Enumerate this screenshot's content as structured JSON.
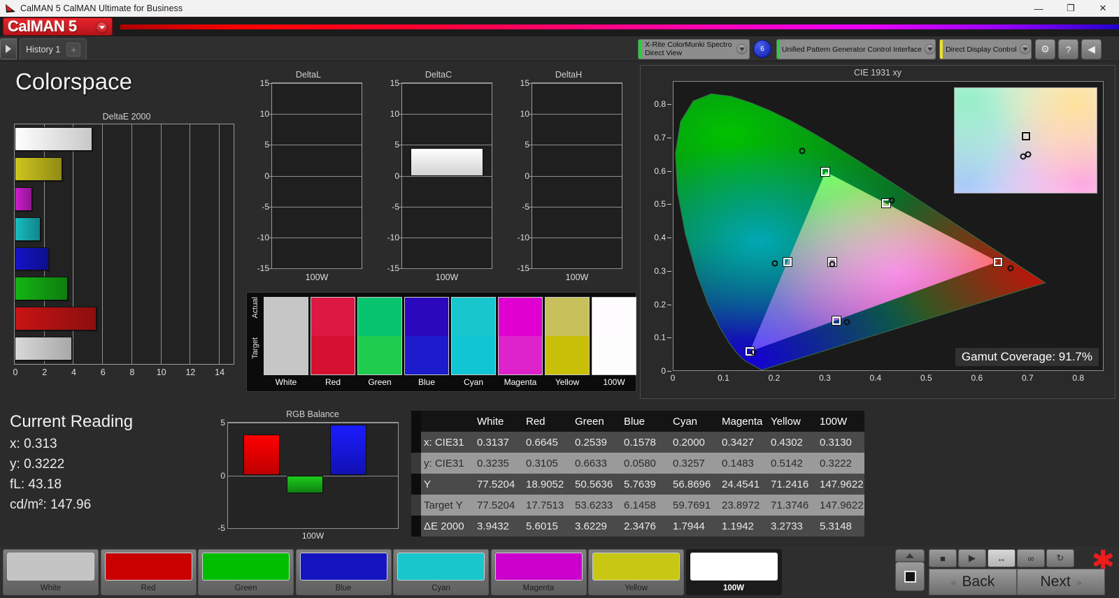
{
  "window": {
    "title": "CalMAN 5 CalMAN Ultimate for Business",
    "app_icon": "calman-logo-icon",
    "controls": {
      "minimize": "—",
      "maximize": "❐",
      "close": "✕"
    }
  },
  "brand": {
    "logo_text": "CalMAN 5",
    "dropdown_icon": "chevron-down-icon"
  },
  "toolbar": {
    "history_tab": "History 1",
    "add_tab": "+",
    "play_icon": "play-icon",
    "meter": {
      "line1": "X-Rite ColorMunki Spectro",
      "line2": "Direct View",
      "stripe_color": "#22d13c"
    },
    "badge": "6",
    "pattern_source": {
      "line1": "Unified Pattern Generator Control Interface",
      "stripe_color": "#22d13c"
    },
    "display_control": {
      "line1": "Direct Display Control",
      "stripe_color": "#e8e22a"
    },
    "buttons": [
      {
        "name": "settings-button",
        "glyph": "⚙"
      },
      {
        "name": "help-button",
        "glyph": "?"
      },
      {
        "name": "collapse-button",
        "glyph": "◀"
      }
    ]
  },
  "page_title": "Colorspace",
  "chart_data": [
    {
      "type": "bar",
      "title": "DeltaE 2000",
      "orientation": "horizontal",
      "categories": [
        "100W",
        "Yellow",
        "Magenta",
        "Cyan",
        "Blue",
        "Green",
        "Red",
        "White"
      ],
      "values": [
        5.3148,
        3.2733,
        1.1942,
        1.7944,
        2.3476,
        3.6229,
        5.6015,
        3.9432
      ],
      "colors": [
        "#ffffff",
        "#cdc61f",
        "#cc1ecc",
        "#18bdc2",
        "#1414c8",
        "#14b414",
        "#c81414",
        "#c8c8c8"
      ],
      "xlabel": "",
      "ylabel": "",
      "xlim": [
        0,
        15
      ],
      "xticks": [
        0,
        2,
        4,
        6,
        8,
        10,
        12,
        14
      ],
      "grid": true
    },
    {
      "type": "bar",
      "title": "DeltaL",
      "categories": [
        "100W"
      ],
      "values": [
        0
      ],
      "ylim": [
        -15,
        15
      ],
      "yticks": [
        15,
        10,
        5,
        0,
        -5,
        -10,
        -15
      ],
      "grid": true
    },
    {
      "type": "bar",
      "title": "DeltaC",
      "categories": [
        "100W"
      ],
      "values": [
        4.5
      ],
      "ylim": [
        -15,
        15
      ],
      "yticks": [
        15,
        10,
        5,
        0,
        -5,
        -10,
        -15
      ],
      "grid": true
    },
    {
      "type": "bar",
      "title": "DeltaH",
      "categories": [
        "100W"
      ],
      "values": [
        0
      ],
      "ylim": [
        -15,
        15
      ],
      "yticks": [
        15,
        10,
        5,
        0,
        -5,
        -10,
        -15
      ],
      "grid": true
    },
    {
      "type": "bar",
      "title": "RGB Balance",
      "categories": [
        "Red",
        "Green",
        "Blue"
      ],
      "values": [
        3.9,
        -1.7,
        4.8
      ],
      "colors": [
        "#e00000",
        "#149614",
        "#1414d2"
      ],
      "ylim": [
        -5,
        5
      ],
      "yticks": [
        5,
        0,
        -5
      ],
      "xlabel": "100W",
      "grid": true
    },
    {
      "type": "scatter",
      "title": "CIE 1931 xy",
      "xlabel": "",
      "ylabel": "",
      "xlim": [
        0,
        0.85
      ],
      "ylim": [
        0,
        0.87
      ],
      "xticks": [
        0,
        0.1,
        0.2,
        0.3,
        0.4,
        0.5,
        0.6,
        0.7,
        0.8
      ],
      "yticks": [
        0,
        0.1,
        0.2,
        0.3,
        0.4,
        0.5,
        0.6,
        0.7,
        0.8
      ],
      "annotation": "Gamut Coverage:  91.7%",
      "series": [
        {
          "name": "Target (square)",
          "points": [
            {
              "label": "Red",
              "x": 0.64,
              "y": 0.33
            },
            {
              "label": "Green",
              "x": 0.3,
              "y": 0.6
            },
            {
              "label": "Blue",
              "x": 0.15,
              "y": 0.06
            },
            {
              "label": "Cyan",
              "x": 0.225,
              "y": 0.329
            },
            {
              "label": "Magenta",
              "x": 0.321,
              "y": 0.154
            },
            {
              "label": "Yellow",
              "x": 0.419,
              "y": 0.505
            },
            {
              "label": "White",
              "x": 0.3127,
              "y": 0.329
            }
          ]
        },
        {
          "name": "Measured (circle)",
          "points": [
            {
              "label": "Red",
              "x": 0.6645,
              "y": 0.3105
            },
            {
              "label": "Green",
              "x": 0.2539,
              "y": 0.6633
            },
            {
              "label": "Blue",
              "x": 0.1578,
              "y": 0.058
            },
            {
              "label": "Cyan",
              "x": 0.2,
              "y": 0.3257
            },
            {
              "label": "Magenta",
              "x": 0.3427,
              "y": 0.1483
            },
            {
              "label": "Yellow",
              "x": 0.4302,
              "y": 0.5142
            },
            {
              "label": "White",
              "x": 0.3137,
              "y": 0.3235
            }
          ]
        }
      ]
    }
  ],
  "deltaE_axis_label": "",
  "dlch_footer": "100W",
  "swatch_strip": {
    "axis_top": "Actual",
    "axis_bottom": "Target",
    "columns": [
      {
        "label": "White",
        "actual": "#c6c6c6",
        "target": "#c6c6c6"
      },
      {
        "label": "Red",
        "actual": "#dc1843",
        "target": "#d61030"
      },
      {
        "label": "Green",
        "actual": "#08c46e",
        "target": "#1ecd4e"
      },
      {
        "label": "Blue",
        "actual": "#2c08bc",
        "target": "#1c1ccd"
      },
      {
        "label": "Cyan",
        "actual": "#18c6cd",
        "target": "#10c6d2"
      },
      {
        "label": "Magenta",
        "actual": "#e000d0",
        "target": "#de22cc"
      },
      {
        "label": "Yellow",
        "actual": "#c8c05a",
        "target": "#c8c008"
      },
      {
        "label": "100W",
        "actual": "#fffcff",
        "target": "#fdfdfd"
      }
    ]
  },
  "current_reading": {
    "heading": "Current Reading",
    "rows": [
      {
        "label": "x:",
        "value": "0.313"
      },
      {
        "label": "y:",
        "value": "0.3222"
      },
      {
        "label": "fL:",
        "value": "43.18"
      },
      {
        "label": "cd/m²:",
        "value": "147.96"
      }
    ]
  },
  "table": {
    "columns": [
      "White",
      "Red",
      "Green",
      "Blue",
      "Cyan",
      "Magenta",
      "Yellow",
      "100W"
    ],
    "rows": [
      {
        "label": "x: CIE31",
        "cells": [
          "0.3137",
          "0.6645",
          "0.2539",
          "0.1578",
          "0.2000",
          "0.3427",
          "0.4302",
          "0.3130"
        ]
      },
      {
        "label": "y: CIE31",
        "cells": [
          "0.3235",
          "0.3105",
          "0.6633",
          "0.0580",
          "0.3257",
          "0.1483",
          "0.5142",
          "0.3222"
        ]
      },
      {
        "label": "Y",
        "cells": [
          "77.5204",
          "18.9052",
          "50.5636",
          "5.7639",
          "56.8696",
          "24.4541",
          "71.2416",
          "147.9622"
        ]
      },
      {
        "label": "Target Y",
        "cells": [
          "77.5204",
          "17.7513",
          "53.6233",
          "6.1458",
          "59.7691",
          "23.8972",
          "71.3746",
          "147.9622"
        ]
      },
      {
        "label": "ΔE 2000",
        "cells": [
          "3.9432",
          "5.6015",
          "3.6229",
          "2.3476",
          "1.7944",
          "1.1942",
          "3.2733",
          "5.3148"
        ]
      }
    ]
  },
  "color_buttons": [
    {
      "label": "White",
      "color": "#c4c4c4",
      "selected": false
    },
    {
      "label": "Red",
      "color": "#c80000",
      "selected": false
    },
    {
      "label": "Green",
      "color": "#00bd00",
      "selected": false
    },
    {
      "label": "Blue",
      "color": "#1414c0",
      "selected": false
    },
    {
      "label": "Cyan",
      "color": "#18c6cc",
      "selected": false
    },
    {
      "label": "Magenta",
      "color": "#cc00cc",
      "selected": false
    },
    {
      "label": "Yellow",
      "color": "#c8c814",
      "selected": false
    },
    {
      "label": "100W",
      "color": "#ffffff",
      "selected": true
    }
  ],
  "nav": {
    "back": "Back",
    "next": "Next",
    "back_chevron": "«",
    "next_chevron": "»",
    "stop_icon": "stop-icon",
    "up_icon": "chevron-up-icon",
    "mini_buttons": [
      {
        "name": "stop-button",
        "glyph": "■",
        "active": false
      },
      {
        "name": "play-button",
        "glyph": "▶",
        "active": false
      },
      {
        "name": "measure-button",
        "glyph": "↔",
        "active": true
      },
      {
        "name": "continuous-button",
        "glyph": "∞",
        "active": false
      },
      {
        "name": "refresh-button",
        "glyph": "↻",
        "active": false
      }
    ],
    "asterisk": "✱"
  }
}
